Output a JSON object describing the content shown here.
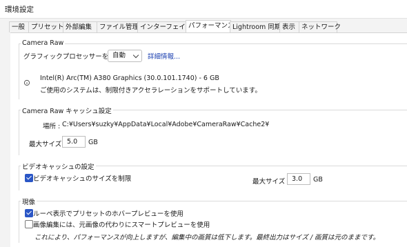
{
  "window": {
    "title": "環境設定"
  },
  "tabs": [
    {
      "label": "一般"
    },
    {
      "label": "プリセット"
    },
    {
      "label": "外部編集"
    },
    {
      "label": "ファイル管理"
    },
    {
      "label": "インターフェイス"
    },
    {
      "label": "パフォーマンス",
      "active": true
    },
    {
      "label": "Lightroom 同期"
    },
    {
      "label": "表示"
    },
    {
      "label": "ネットワーク"
    }
  ],
  "camera_raw": {
    "legend": "Camera Raw",
    "gpu_label": "グラフィックプロセッサーを使用 :",
    "gpu_value": "自動",
    "details_link": "詳細情報...",
    "gpu_name": "Intel(R) Arc(TM) A380 Graphics (30.0.101.1740) - 6 GB",
    "gpu_status": "ご使用のシステムは、制限付きアクセラレーションをサポートしています。",
    "status_icon": "info-icon"
  },
  "cache": {
    "legend": "Camera Raw キャッシュ設定",
    "location_label": "場所 :",
    "location_value": "C:¥Users¥suzky¥AppData¥Local¥Adobe¥CameraRaw¥Cache2¥",
    "max_size_label": "最大サイズ :",
    "max_size_value": "5.0",
    "max_size_unit": "GB"
  },
  "video_cache": {
    "legend": "ビデオキャッシュの設定",
    "limit_label": "ビデオキャッシュのサイズを制限",
    "limit_checked": true,
    "max_size_label": "最大サイズ :",
    "max_size_value": "3.0",
    "max_size_unit": "GB"
  },
  "develop": {
    "legend": "現像",
    "loupe_label": "ルーペ表示でプリセットのホバープレビューを使用",
    "loupe_checked": true,
    "smart_preview_label": "画像編集には、元画像の代わりにスマートプレビューを使用",
    "smart_preview_checked": false,
    "note": "これにより、パフォーマンスが向上しますが、編集中の画質は低下します。最終出力はサイズ / 画質は元のままです。"
  },
  "colors": {
    "accent": "#2a56c6",
    "link": "#1a3fb0"
  }
}
